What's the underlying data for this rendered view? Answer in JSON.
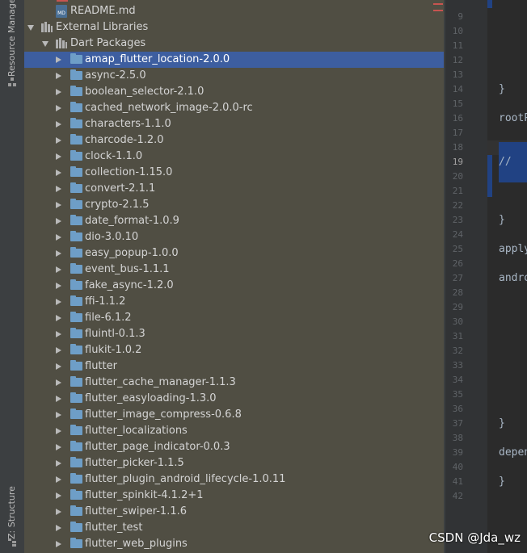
{
  "tool_strip": {
    "resource_manager_label": "Resource Manager",
    "structure_label": "Z: Structure"
  },
  "project_tree": {
    "readme_label": "README.md",
    "readme_badge": "MD",
    "external_libraries_label": "External Libraries",
    "dart_packages_label": "Dart Packages",
    "packages": [
      {
        "label": "amap_flutter_location-2.0.0",
        "selected": true
      },
      {
        "label": "async-2.5.0"
      },
      {
        "label": "boolean_selector-2.1.0"
      },
      {
        "label": "cached_network_image-2.0.0-rc"
      },
      {
        "label": "characters-1.1.0"
      },
      {
        "label": "charcode-1.2.0"
      },
      {
        "label": "clock-1.1.0"
      },
      {
        "label": "collection-1.15.0"
      },
      {
        "label": "convert-2.1.1"
      },
      {
        "label": "crypto-2.1.5"
      },
      {
        "label": "date_format-1.0.9"
      },
      {
        "label": "dio-3.0.10"
      },
      {
        "label": "easy_popup-1.0.0"
      },
      {
        "label": "event_bus-1.1.1"
      },
      {
        "label": "fake_async-1.2.0"
      },
      {
        "label": "ffi-1.1.2"
      },
      {
        "label": "file-6.1.2"
      },
      {
        "label": "fluintl-0.1.3"
      },
      {
        "label": "flukit-1.0.2"
      },
      {
        "label": "flutter"
      },
      {
        "label": "flutter_cache_manager-1.1.3"
      },
      {
        "label": "flutter_easyloading-1.3.0"
      },
      {
        "label": "flutter_image_compress-0.6.8"
      },
      {
        "label": "flutter_localizations"
      },
      {
        "label": "flutter_page_indicator-0.0.3"
      },
      {
        "label": "flutter_picker-1.1.5"
      },
      {
        "label": "flutter_plugin_android_lifecycle-1.0.11"
      },
      {
        "label": "flutter_spinkit-4.1.2+1"
      },
      {
        "label": "flutter_swiper-1.1.6"
      },
      {
        "label": "flutter_test"
      },
      {
        "label": "flutter_web_plugins"
      }
    ]
  },
  "editor": {
    "line_numbers": [
      "9",
      "10",
      "11",
      "12",
      "13",
      "14",
      "15",
      "16",
      "17",
      "18",
      "19",
      "20",
      "21",
      "22",
      "23",
      "24",
      "25",
      "26",
      "27",
      "28",
      "29",
      "30",
      "31",
      "32",
      "33",
      "34",
      "35",
      "36",
      "37",
      "38",
      "39",
      "40",
      "41",
      "42"
    ],
    "current_line": "19",
    "code_lines": [
      {
        "line": "14",
        "text": "}"
      },
      {
        "line": "16",
        "text": "rootP"
      },
      {
        "line": "19",
        "text": "//"
      },
      {
        "line": "23",
        "text": "}"
      },
      {
        "line": "25",
        "text": "apply"
      },
      {
        "line": "27",
        "text": "andro"
      },
      {
        "line": "37",
        "text": "}"
      },
      {
        "line": "39",
        "text": "depen"
      },
      {
        "line": "41",
        "text": "}"
      }
    ]
  },
  "watermark": "CSDN @Jda_wz",
  "colors": {
    "panel_bg": "#504e43",
    "selection": "#3d5ea0",
    "editor_bg": "#2b2b2b",
    "folder": "#6e9ec7"
  }
}
